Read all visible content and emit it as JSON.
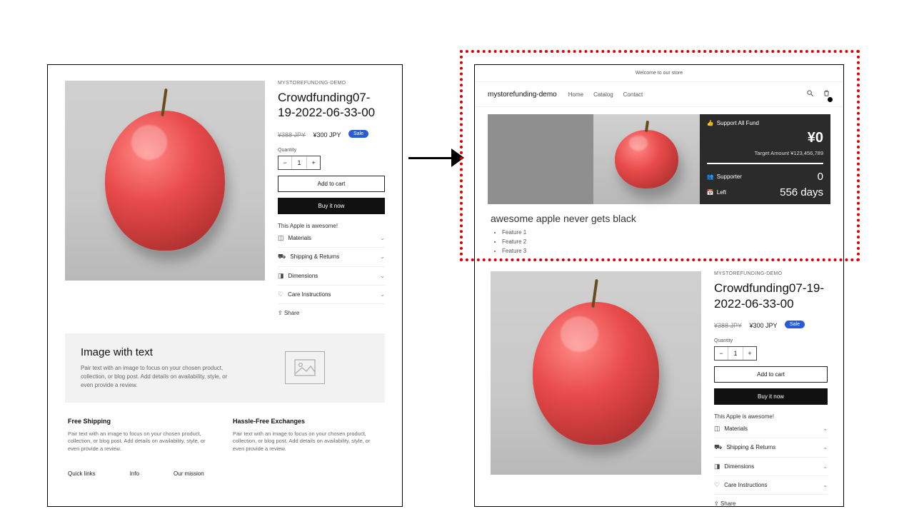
{
  "left": {
    "vendor": "MYSTOREFUNDING-DEMO",
    "title": "Crowdfunding07-19-2022-06-33-00",
    "old_price": "¥388 JPY",
    "new_price": "¥300 JPY",
    "sale_tag": "Sale",
    "qty_label": "Quantity",
    "qty_minus": "−",
    "qty_val": "1",
    "qty_plus": "+",
    "add_to_cart": "Add to cart",
    "buy_now": "Buy it now",
    "desc": "This Apple is awesome!",
    "acc": [
      "Materials",
      "Shipping & Returns",
      "Dimensions",
      "Care Instructions"
    ],
    "share": "Share",
    "iw_title": "Image with text",
    "iw_body": "Pair text with an image to focus on your chosen product, collection, or blog post. Add details on availability, style, or even provide a review.",
    "feat1_t": "Free Shipping",
    "feat_body": "Pair text with an image to focus on your chosen product, collection, or blog post. Add details on availability, style, or even provide a review.",
    "feat2_t": "Hassle-Free Exchanges",
    "footer": [
      "Quick links",
      "Info",
      "Our mission"
    ]
  },
  "right": {
    "welcome": "Welcome to our store",
    "brand": "mystorefunding-demo",
    "nav": [
      "Home",
      "Catalog",
      "Contact"
    ],
    "fund_title": "Support All Fund",
    "fund_amount": "¥0",
    "target": "Target Amount ¥123,456,789",
    "supporter_label": "Supporter",
    "supporter_val": "0",
    "left_label": "Left",
    "left_val": "556 days",
    "tagline": "awesome apple never gets black",
    "bullets": [
      "Feature 1",
      "Feature 2",
      "Feature 3"
    ],
    "vendor": "MYSTOREFUNDING-DEMO",
    "title": "Crowdfunding07-19-2022-06-33-00",
    "old_price": "¥388 JPY",
    "new_price": "¥300 JPY",
    "sale_tag": "Sale",
    "qty_label": "Quantity",
    "qty_minus": "−",
    "qty_val": "1",
    "qty_plus": "+",
    "add_to_cart": "Add to cart",
    "buy_now": "Buy it now",
    "desc": "This Apple is awesome!",
    "acc": [
      "Materials",
      "Shipping & Returns",
      "Dimensions",
      "Care Instructions"
    ],
    "share": "Share"
  },
  "acc_icons": [
    "◫",
    "⛟",
    "◨",
    "♡"
  ]
}
